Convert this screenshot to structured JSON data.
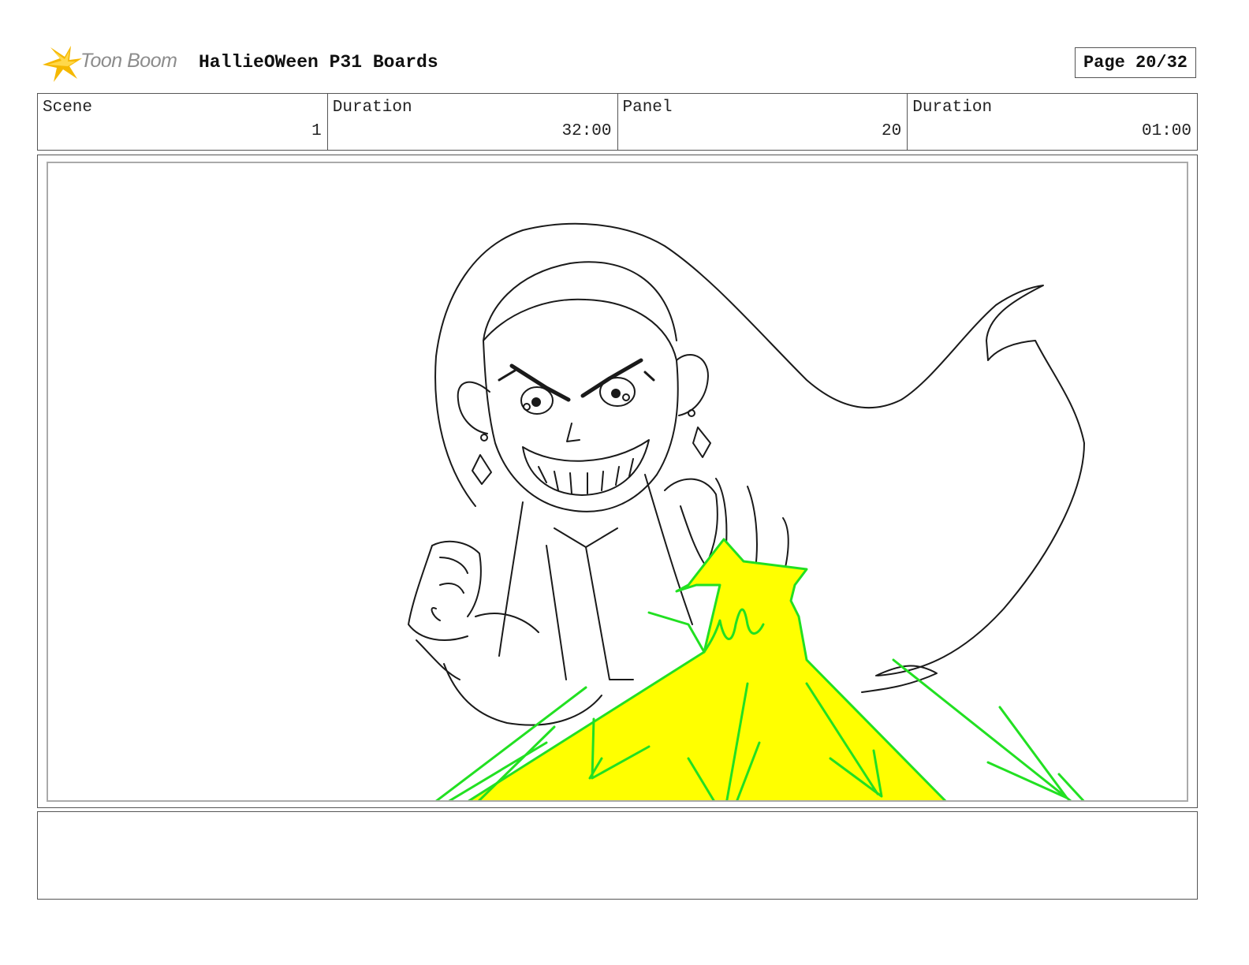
{
  "header": {
    "logo_text": "Toon Boom",
    "title": "HallieOWeen P31 Boards",
    "page_label": "Page 20/32"
  },
  "info": [
    {
      "label": "Scene",
      "value": "1"
    },
    {
      "label": "Duration",
      "value": "32:00"
    },
    {
      "label": "Panel",
      "value": "20"
    },
    {
      "label": "Duration",
      "value": "01:00"
    }
  ],
  "panel": {
    "drawing_icon": "storyboard-sketch",
    "colors": {
      "line": "#1a1a1a",
      "effect_fill": "#ffff00",
      "effect_stroke": "#22e022",
      "logo_accent": "#f5b800"
    }
  },
  "notes": {
    "text": ""
  }
}
